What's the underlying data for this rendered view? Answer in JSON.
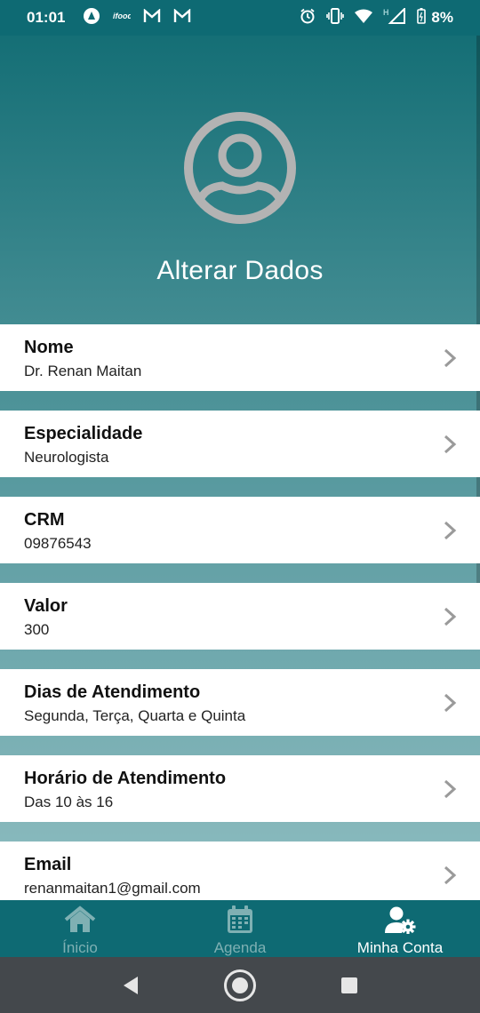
{
  "status_bar": {
    "time": "01:01",
    "battery": "8%",
    "network": "H"
  },
  "header": {
    "title": "Alterar Dados"
  },
  "fields": [
    {
      "label": "Nome",
      "value": "Dr. Renan Maitan"
    },
    {
      "label": "Especialidade",
      "value": "Neurologista"
    },
    {
      "label": "CRM",
      "value": "09876543"
    },
    {
      "label": "Valor",
      "value": "300"
    },
    {
      "label": "Dias de Atendimento",
      "value": "Segunda, Terça, Quarta e Quinta"
    },
    {
      "label": "Horário de Atendimento",
      "value": "Das 10 às 16"
    },
    {
      "label": "Email",
      "value": "renanmaitan1@gmail.com"
    }
  ],
  "bottom_nav": {
    "items": [
      {
        "label": "Ínicio",
        "icon": "home-icon",
        "active": false
      },
      {
        "label": "Agenda",
        "icon": "calendar-icon",
        "active": false
      },
      {
        "label": "Minha Conta",
        "icon": "user-gear-icon",
        "active": true
      }
    ]
  },
  "colors": {
    "primary": "#0e6a73",
    "nav_inactive": "#7fb0b3",
    "system_nav": "#44484c"
  }
}
